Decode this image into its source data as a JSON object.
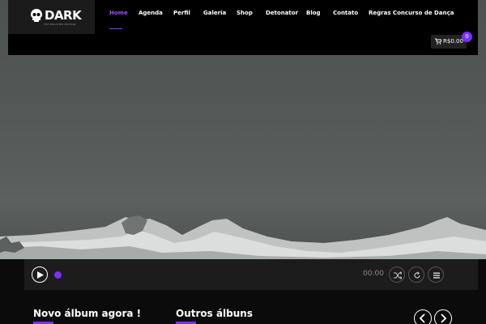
{
  "brand": {
    "name": "DARK",
    "tagline": "THE POLISHED EDITION"
  },
  "nav": {
    "items": [
      {
        "label": "Home",
        "active": true
      },
      {
        "label": "Agenda",
        "active": false
      },
      {
        "label": "Perfil",
        "active": false
      },
      {
        "label": "Galeria",
        "active": false
      },
      {
        "label": "Shop",
        "active": false
      },
      {
        "label": "Detonator",
        "active": false
      },
      {
        "label": "Blog",
        "active": false
      },
      {
        "label": "Contato",
        "active": false
      },
      {
        "label": "Regras Concurso de Dança",
        "active": false
      }
    ]
  },
  "cart": {
    "amount": "R$0.00",
    "count": "0",
    "icon": "cart-icon"
  },
  "player": {
    "time": "00:00",
    "icons": [
      "play-icon",
      "shuffle-icon",
      "repeat-icon",
      "playlist-icon"
    ]
  },
  "sections": {
    "new_album_title": "Novo álbum agora !",
    "other_albums_title": "Outros álbuns"
  },
  "colors": {
    "accent": "#7b2ff7",
    "header_bg": "#000000",
    "player_bg": "#1c1c1c"
  }
}
